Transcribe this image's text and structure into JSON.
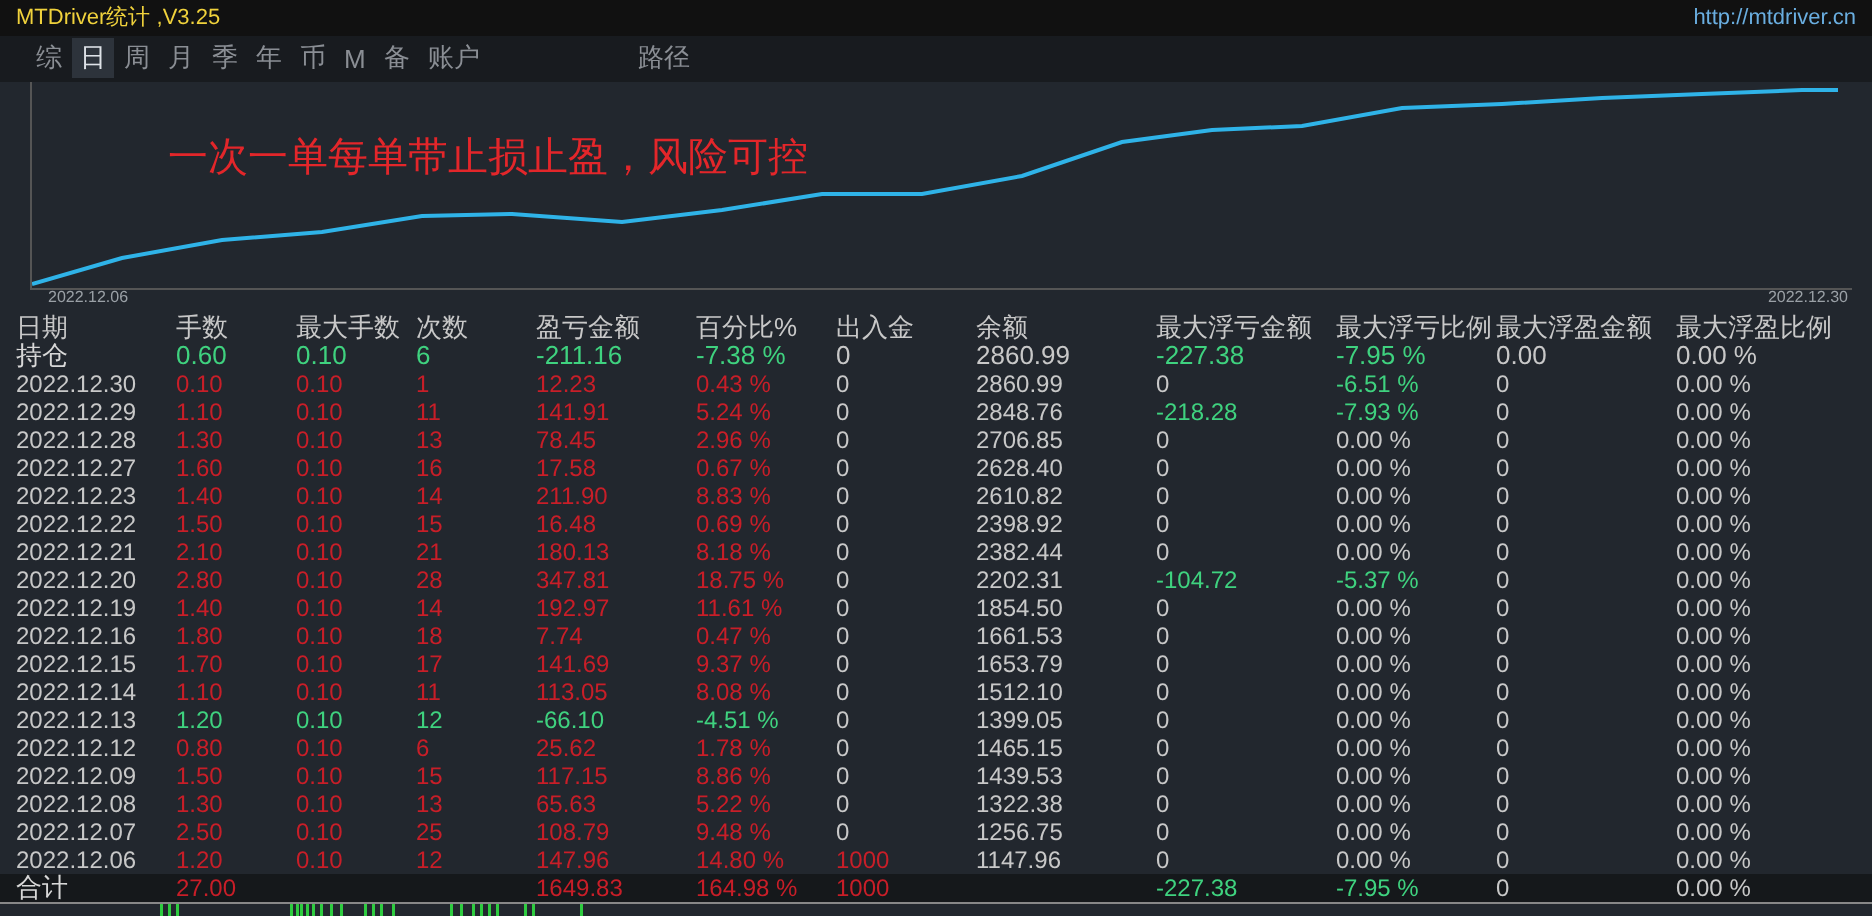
{
  "window": {
    "title": "MTDriver统计 ,V3.25",
    "link": "http://mtdriver.cn"
  },
  "tabs": [
    {
      "label": "综",
      "selected": false
    },
    {
      "label": "日",
      "selected": true
    },
    {
      "label": "周",
      "selected": false
    },
    {
      "label": "月",
      "selected": false
    },
    {
      "label": "季",
      "selected": false
    },
    {
      "label": "年",
      "selected": false
    },
    {
      "label": "币",
      "selected": false
    },
    {
      "label": "M",
      "selected": false
    },
    {
      "label": "备",
      "selected": false
    },
    {
      "label": "账户",
      "selected": false
    },
    {
      "label": "路径",
      "selected": false
    }
  ],
  "chart": {
    "caption": "一次一单每单带止损止盈，风险可控",
    "start_label": "2022.12.06",
    "end_label": "2022.12.30"
  },
  "table": {
    "columns": [
      "日期",
      "手数",
      "最大手数",
      "次数",
      "盈亏金额",
      "百分比%",
      "出入金",
      "余额",
      "最大浮亏金额",
      "最大浮亏比例",
      "最大浮盈金额",
      "最大浮盈比例"
    ],
    "rows": [
      {
        "kind": "position",
        "cells": [
          {
            "text": "持仓",
            "color": "#d8d8d8"
          },
          {
            "text": "0.60",
            "color": "#3fd27f"
          },
          {
            "text": "0.10",
            "color": "#3fd27f"
          },
          {
            "text": "6",
            "color": "#3fd27f"
          },
          {
            "text": "-211.16",
            "color": "#3fd27f"
          },
          {
            "text": "-7.38 %",
            "color": "#3fd27f"
          },
          {
            "text": "0",
            "color": "#c8c8c8"
          },
          {
            "text": "2860.99",
            "color": "#c8c8c8"
          },
          {
            "text": "-227.38",
            "color": "#3fd27f"
          },
          {
            "text": "-7.95 %",
            "color": "#3fd27f"
          },
          {
            "text": "0.00",
            "color": "#c8c8c8"
          },
          {
            "text": "0.00 %",
            "color": "#c8c8c8"
          }
        ]
      },
      {
        "kind": "day",
        "cells": [
          {
            "text": "2022.12.30",
            "color": "#c8c8c8"
          },
          {
            "text": "0.10",
            "color": "#c81e28"
          },
          {
            "text": "0.10",
            "color": "#c81e28"
          },
          {
            "text": "1",
            "color": "#c81e28"
          },
          {
            "text": "12.23",
            "color": "#c81e28"
          },
          {
            "text": "0.43 %",
            "color": "#c81e28"
          },
          {
            "text": "0",
            "color": "#c8c8c8"
          },
          {
            "text": "2860.99",
            "color": "#c8c8c8"
          },
          {
            "text": "0",
            "color": "#c8c8c8"
          },
          {
            "text": "-6.51 %",
            "color": "#3fd27f"
          },
          {
            "text": "0",
            "color": "#c8c8c8"
          },
          {
            "text": "0.00 %",
            "color": "#c8c8c8"
          }
        ]
      },
      {
        "kind": "day",
        "cells": [
          {
            "text": "2022.12.29",
            "color": "#c8c8c8"
          },
          {
            "text": "1.10",
            "color": "#c81e28"
          },
          {
            "text": "0.10",
            "color": "#c81e28"
          },
          {
            "text": "11",
            "color": "#c81e28"
          },
          {
            "text": "141.91",
            "color": "#c81e28"
          },
          {
            "text": "5.24 %",
            "color": "#c81e28"
          },
          {
            "text": "0",
            "color": "#c8c8c8"
          },
          {
            "text": "2848.76",
            "color": "#c8c8c8"
          },
          {
            "text": "-218.28",
            "color": "#3fd27f"
          },
          {
            "text": "-7.93 %",
            "color": "#3fd27f"
          },
          {
            "text": "0",
            "color": "#c8c8c8"
          },
          {
            "text": "0.00 %",
            "color": "#c8c8c8"
          }
        ]
      },
      {
        "kind": "day",
        "cells": [
          {
            "text": "2022.12.28",
            "color": "#c8c8c8"
          },
          {
            "text": "1.30",
            "color": "#c81e28"
          },
          {
            "text": "0.10",
            "color": "#c81e28"
          },
          {
            "text": "13",
            "color": "#c81e28"
          },
          {
            "text": "78.45",
            "color": "#c81e28"
          },
          {
            "text": "2.96 %",
            "color": "#c81e28"
          },
          {
            "text": "0",
            "color": "#c8c8c8"
          },
          {
            "text": "2706.85",
            "color": "#c8c8c8"
          },
          {
            "text": "0",
            "color": "#c8c8c8"
          },
          {
            "text": "0.00 %",
            "color": "#c8c8c8"
          },
          {
            "text": "0",
            "color": "#c8c8c8"
          },
          {
            "text": "0.00 %",
            "color": "#c8c8c8"
          }
        ]
      },
      {
        "kind": "day",
        "cells": [
          {
            "text": "2022.12.27",
            "color": "#c8c8c8"
          },
          {
            "text": "1.60",
            "color": "#c81e28"
          },
          {
            "text": "0.10",
            "color": "#c81e28"
          },
          {
            "text": "16",
            "color": "#c81e28"
          },
          {
            "text": "17.58",
            "color": "#c81e28"
          },
          {
            "text": "0.67 %",
            "color": "#c81e28"
          },
          {
            "text": "0",
            "color": "#c8c8c8"
          },
          {
            "text": "2628.40",
            "color": "#c8c8c8"
          },
          {
            "text": "0",
            "color": "#c8c8c8"
          },
          {
            "text": "0.00 %",
            "color": "#c8c8c8"
          },
          {
            "text": "0",
            "color": "#c8c8c8"
          },
          {
            "text": "0.00 %",
            "color": "#c8c8c8"
          }
        ]
      },
      {
        "kind": "day",
        "cells": [
          {
            "text": "2022.12.23",
            "color": "#c8c8c8"
          },
          {
            "text": "1.40",
            "color": "#c81e28"
          },
          {
            "text": "0.10",
            "color": "#c81e28"
          },
          {
            "text": "14",
            "color": "#c81e28"
          },
          {
            "text": "211.90",
            "color": "#c81e28"
          },
          {
            "text": "8.83 %",
            "color": "#c81e28"
          },
          {
            "text": "0",
            "color": "#c8c8c8"
          },
          {
            "text": "2610.82",
            "color": "#c8c8c8"
          },
          {
            "text": "0",
            "color": "#c8c8c8"
          },
          {
            "text": "0.00 %",
            "color": "#c8c8c8"
          },
          {
            "text": "0",
            "color": "#c8c8c8"
          },
          {
            "text": "0.00 %",
            "color": "#c8c8c8"
          }
        ]
      },
      {
        "kind": "day",
        "cells": [
          {
            "text": "2022.12.22",
            "color": "#c8c8c8"
          },
          {
            "text": "1.50",
            "color": "#c81e28"
          },
          {
            "text": "0.10",
            "color": "#c81e28"
          },
          {
            "text": "15",
            "color": "#c81e28"
          },
          {
            "text": "16.48",
            "color": "#c81e28"
          },
          {
            "text": "0.69 %",
            "color": "#c81e28"
          },
          {
            "text": "0",
            "color": "#c8c8c8"
          },
          {
            "text": "2398.92",
            "color": "#c8c8c8"
          },
          {
            "text": "0",
            "color": "#c8c8c8"
          },
          {
            "text": "0.00 %",
            "color": "#c8c8c8"
          },
          {
            "text": "0",
            "color": "#c8c8c8"
          },
          {
            "text": "0.00 %",
            "color": "#c8c8c8"
          }
        ]
      },
      {
        "kind": "day",
        "cells": [
          {
            "text": "2022.12.21",
            "color": "#c8c8c8"
          },
          {
            "text": "2.10",
            "color": "#c81e28"
          },
          {
            "text": "0.10",
            "color": "#c81e28"
          },
          {
            "text": "21",
            "color": "#c81e28"
          },
          {
            "text": "180.13",
            "color": "#c81e28"
          },
          {
            "text": "8.18 %",
            "color": "#c81e28"
          },
          {
            "text": "0",
            "color": "#c8c8c8"
          },
          {
            "text": "2382.44",
            "color": "#c8c8c8"
          },
          {
            "text": "0",
            "color": "#c8c8c8"
          },
          {
            "text": "0.00 %",
            "color": "#c8c8c8"
          },
          {
            "text": "0",
            "color": "#c8c8c8"
          },
          {
            "text": "0.00 %",
            "color": "#c8c8c8"
          }
        ]
      },
      {
        "kind": "day",
        "cells": [
          {
            "text": "2022.12.20",
            "color": "#c8c8c8"
          },
          {
            "text": "2.80",
            "color": "#c81e28"
          },
          {
            "text": "0.10",
            "color": "#c81e28"
          },
          {
            "text": "28",
            "color": "#c81e28"
          },
          {
            "text": "347.81",
            "color": "#c81e28"
          },
          {
            "text": "18.75 %",
            "color": "#c81e28"
          },
          {
            "text": "0",
            "color": "#c8c8c8"
          },
          {
            "text": "2202.31",
            "color": "#c8c8c8"
          },
          {
            "text": "-104.72",
            "color": "#3fd27f"
          },
          {
            "text": "-5.37 %",
            "color": "#3fd27f"
          },
          {
            "text": "0",
            "color": "#c8c8c8"
          },
          {
            "text": "0.00 %",
            "color": "#c8c8c8"
          }
        ]
      },
      {
        "kind": "day",
        "cells": [
          {
            "text": "2022.12.19",
            "color": "#c8c8c8"
          },
          {
            "text": "1.40",
            "color": "#c81e28"
          },
          {
            "text": "0.10",
            "color": "#c81e28"
          },
          {
            "text": "14",
            "color": "#c81e28"
          },
          {
            "text": "192.97",
            "color": "#c81e28"
          },
          {
            "text": "11.61 %",
            "color": "#c81e28"
          },
          {
            "text": "0",
            "color": "#c8c8c8"
          },
          {
            "text": "1854.50",
            "color": "#c8c8c8"
          },
          {
            "text": "0",
            "color": "#c8c8c8"
          },
          {
            "text": "0.00 %",
            "color": "#c8c8c8"
          },
          {
            "text": "0",
            "color": "#c8c8c8"
          },
          {
            "text": "0.00 %",
            "color": "#c8c8c8"
          }
        ]
      },
      {
        "kind": "day",
        "cells": [
          {
            "text": "2022.12.16",
            "color": "#c8c8c8"
          },
          {
            "text": "1.80",
            "color": "#c81e28"
          },
          {
            "text": "0.10",
            "color": "#c81e28"
          },
          {
            "text": "18",
            "color": "#c81e28"
          },
          {
            "text": "7.74",
            "color": "#c81e28"
          },
          {
            "text": "0.47 %",
            "color": "#c81e28"
          },
          {
            "text": "0",
            "color": "#c8c8c8"
          },
          {
            "text": "1661.53",
            "color": "#c8c8c8"
          },
          {
            "text": "0",
            "color": "#c8c8c8"
          },
          {
            "text": "0.00 %",
            "color": "#c8c8c8"
          },
          {
            "text": "0",
            "color": "#c8c8c8"
          },
          {
            "text": "0.00 %",
            "color": "#c8c8c8"
          }
        ]
      },
      {
        "kind": "day",
        "cells": [
          {
            "text": "2022.12.15",
            "color": "#c8c8c8"
          },
          {
            "text": "1.70",
            "color": "#c81e28"
          },
          {
            "text": "0.10",
            "color": "#c81e28"
          },
          {
            "text": "17",
            "color": "#c81e28"
          },
          {
            "text": "141.69",
            "color": "#c81e28"
          },
          {
            "text": "9.37 %",
            "color": "#c81e28"
          },
          {
            "text": "0",
            "color": "#c8c8c8"
          },
          {
            "text": "1653.79",
            "color": "#c8c8c8"
          },
          {
            "text": "0",
            "color": "#c8c8c8"
          },
          {
            "text": "0.00 %",
            "color": "#c8c8c8"
          },
          {
            "text": "0",
            "color": "#c8c8c8"
          },
          {
            "text": "0.00 %",
            "color": "#c8c8c8"
          }
        ]
      },
      {
        "kind": "day",
        "cells": [
          {
            "text": "2022.12.14",
            "color": "#c8c8c8"
          },
          {
            "text": "1.10",
            "color": "#c81e28"
          },
          {
            "text": "0.10",
            "color": "#c81e28"
          },
          {
            "text": "11",
            "color": "#c81e28"
          },
          {
            "text": "113.05",
            "color": "#c81e28"
          },
          {
            "text": "8.08 %",
            "color": "#c81e28"
          },
          {
            "text": "0",
            "color": "#c8c8c8"
          },
          {
            "text": "1512.10",
            "color": "#c8c8c8"
          },
          {
            "text": "0",
            "color": "#c8c8c8"
          },
          {
            "text": "0.00 %",
            "color": "#c8c8c8"
          },
          {
            "text": "0",
            "color": "#c8c8c8"
          },
          {
            "text": "0.00 %",
            "color": "#c8c8c8"
          }
        ]
      },
      {
        "kind": "day",
        "cells": [
          {
            "text": "2022.12.13",
            "color": "#c8c8c8"
          },
          {
            "text": "1.20",
            "color": "#3fd27f"
          },
          {
            "text": "0.10",
            "color": "#3fd27f"
          },
          {
            "text": "12",
            "color": "#3fd27f"
          },
          {
            "text": "-66.10",
            "color": "#3fd27f"
          },
          {
            "text": "-4.51 %",
            "color": "#3fd27f"
          },
          {
            "text": "0",
            "color": "#c8c8c8"
          },
          {
            "text": "1399.05",
            "color": "#c8c8c8"
          },
          {
            "text": "0",
            "color": "#c8c8c8"
          },
          {
            "text": "0.00 %",
            "color": "#c8c8c8"
          },
          {
            "text": "0",
            "color": "#c8c8c8"
          },
          {
            "text": "0.00 %",
            "color": "#c8c8c8"
          }
        ]
      },
      {
        "kind": "day",
        "cells": [
          {
            "text": "2022.12.12",
            "color": "#c8c8c8"
          },
          {
            "text": "0.80",
            "color": "#c81e28"
          },
          {
            "text": "0.10",
            "color": "#c81e28"
          },
          {
            "text": "6",
            "color": "#c81e28"
          },
          {
            "text": "25.62",
            "color": "#c81e28"
          },
          {
            "text": "1.78 %",
            "color": "#c81e28"
          },
          {
            "text": "0",
            "color": "#c8c8c8"
          },
          {
            "text": "1465.15",
            "color": "#c8c8c8"
          },
          {
            "text": "0",
            "color": "#c8c8c8"
          },
          {
            "text": "0.00 %",
            "color": "#c8c8c8"
          },
          {
            "text": "0",
            "color": "#c8c8c8"
          },
          {
            "text": "0.00 %",
            "color": "#c8c8c8"
          }
        ]
      },
      {
        "kind": "day",
        "cells": [
          {
            "text": "2022.12.09",
            "color": "#c8c8c8"
          },
          {
            "text": "1.50",
            "color": "#c81e28"
          },
          {
            "text": "0.10",
            "color": "#c81e28"
          },
          {
            "text": "15",
            "color": "#c81e28"
          },
          {
            "text": "117.15",
            "color": "#c81e28"
          },
          {
            "text": "8.86 %",
            "color": "#c81e28"
          },
          {
            "text": "0",
            "color": "#c8c8c8"
          },
          {
            "text": "1439.53",
            "color": "#c8c8c8"
          },
          {
            "text": "0",
            "color": "#c8c8c8"
          },
          {
            "text": "0.00 %",
            "color": "#c8c8c8"
          },
          {
            "text": "0",
            "color": "#c8c8c8"
          },
          {
            "text": "0.00 %",
            "color": "#c8c8c8"
          }
        ]
      },
      {
        "kind": "day",
        "cells": [
          {
            "text": "2022.12.08",
            "color": "#c8c8c8"
          },
          {
            "text": "1.30",
            "color": "#c81e28"
          },
          {
            "text": "0.10",
            "color": "#c81e28"
          },
          {
            "text": "13",
            "color": "#c81e28"
          },
          {
            "text": "65.63",
            "color": "#c81e28"
          },
          {
            "text": "5.22 %",
            "color": "#c81e28"
          },
          {
            "text": "0",
            "color": "#c8c8c8"
          },
          {
            "text": "1322.38",
            "color": "#c8c8c8"
          },
          {
            "text": "0",
            "color": "#c8c8c8"
          },
          {
            "text": "0.00 %",
            "color": "#c8c8c8"
          },
          {
            "text": "0",
            "color": "#c8c8c8"
          },
          {
            "text": "0.00 %",
            "color": "#c8c8c8"
          }
        ]
      },
      {
        "kind": "day",
        "cells": [
          {
            "text": "2022.12.07",
            "color": "#c8c8c8"
          },
          {
            "text": "2.50",
            "color": "#c81e28"
          },
          {
            "text": "0.10",
            "color": "#c81e28"
          },
          {
            "text": "25",
            "color": "#c81e28"
          },
          {
            "text": "108.79",
            "color": "#c81e28"
          },
          {
            "text": "9.48 %",
            "color": "#c81e28"
          },
          {
            "text": "0",
            "color": "#c8c8c8"
          },
          {
            "text": "1256.75",
            "color": "#c8c8c8"
          },
          {
            "text": "0",
            "color": "#c8c8c8"
          },
          {
            "text": "0.00 %",
            "color": "#c8c8c8"
          },
          {
            "text": "0",
            "color": "#c8c8c8"
          },
          {
            "text": "0.00 %",
            "color": "#c8c8c8"
          }
        ]
      },
      {
        "kind": "day",
        "cells": [
          {
            "text": "2022.12.06",
            "color": "#c8c8c8"
          },
          {
            "text": "1.20",
            "color": "#c81e28"
          },
          {
            "text": "0.10",
            "color": "#c81e28"
          },
          {
            "text": "12",
            "color": "#c81e28"
          },
          {
            "text": "147.96",
            "color": "#c81e28"
          },
          {
            "text": "14.80 %",
            "color": "#c81e28"
          },
          {
            "text": "1000",
            "color": "#c81e28"
          },
          {
            "text": "1147.96",
            "color": "#c8c8c8"
          },
          {
            "text": "0",
            "color": "#c8c8c8"
          },
          {
            "text": "0.00 %",
            "color": "#c8c8c8"
          },
          {
            "text": "0",
            "color": "#c8c8c8"
          },
          {
            "text": "0.00 %",
            "color": "#c8c8c8"
          }
        ]
      },
      {
        "kind": "total",
        "cells": [
          {
            "text": "合计",
            "color": "#d8d8d8"
          },
          {
            "text": "27.00",
            "color": "#c81e28"
          },
          null,
          null,
          {
            "text": "1649.83",
            "color": "#c81e28"
          },
          {
            "text": "164.98 %",
            "color": "#c81e28"
          },
          {
            "text": "1000",
            "color": "#c81e28"
          },
          null,
          {
            "text": "-227.38",
            "color": "#3fd27f"
          },
          {
            "text": "-7.95 %",
            "color": "#3fd27f"
          },
          {
            "text": "0",
            "color": "#c8c8c8"
          },
          {
            "text": "0.00 %",
            "color": "#c8c8c8"
          }
        ]
      }
    ]
  }
}
